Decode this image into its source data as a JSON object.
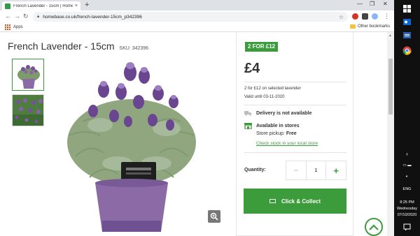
{
  "browser": {
    "tab_title": "French Lavender - 15cm | Homeba",
    "tab_close": "×",
    "new_tab": "+",
    "url": "homebase.co.uk/french-lavender-15cm_p342396",
    "bookmarks": {
      "apps": "Apps",
      "other": "Other bookmarks"
    }
  },
  "product": {
    "title": "French Lavender - 15cm",
    "sku": "SKU: 342396"
  },
  "purchase": {
    "promo": "2 FOR £12",
    "price": "£4",
    "offer": "2 for £12 on selected lavender",
    "valid": "Valid until 03-11-2020",
    "delivery": "Delivery is not available",
    "available": "Available in stores",
    "pickup_label": "Store pickup: ",
    "pickup_value": "Free",
    "check_stock": "Check stock in your local store",
    "quantity_label": "Quantity:",
    "quantity_value": "1",
    "minus": "−",
    "plus": "+",
    "cta": "Click & Collect"
  },
  "taskbar": {
    "lang": "ENG",
    "time": "8:25 PM",
    "day": "Wednesday",
    "date": "07/10/2020"
  },
  "colors": {
    "brand_green": "#3c9c3c",
    "lavender": "#7a4fa0",
    "pot": "#8b6aa6"
  }
}
